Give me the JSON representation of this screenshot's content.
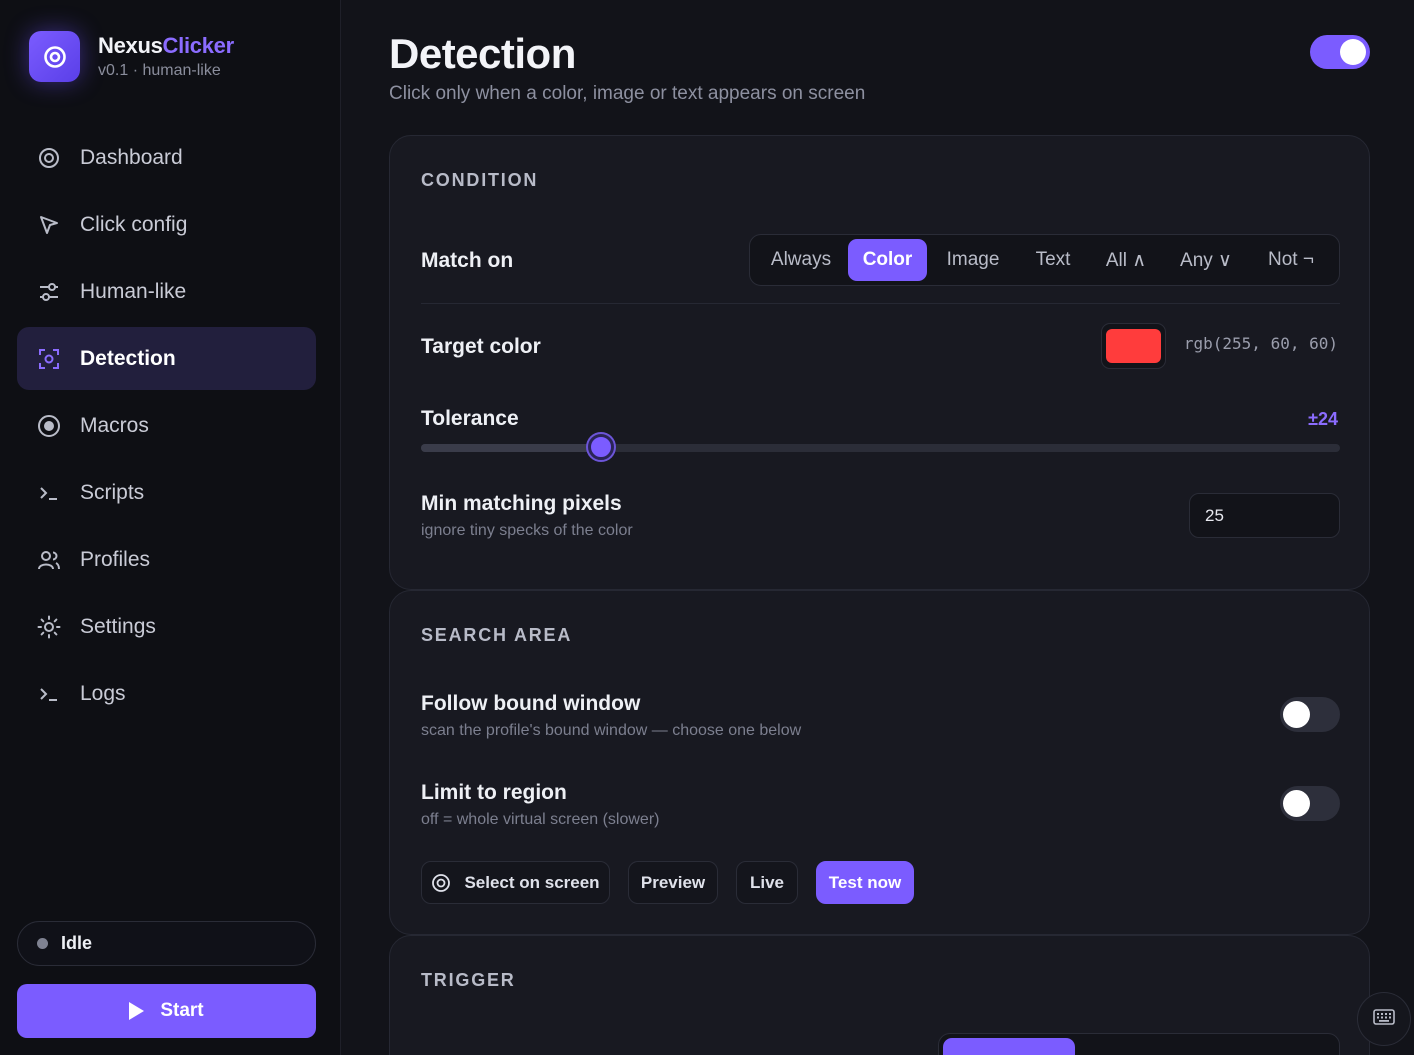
{
  "brand": {
    "name_part1": "Nexus",
    "name_part2": "Clicker",
    "subtitle": "v0.1 · human-like",
    "accent": "#7b5cff"
  },
  "nav": {
    "items": [
      {
        "label": "Dashboard",
        "icon": "target-icon"
      },
      {
        "label": "Click config",
        "icon": "cursor-icon"
      },
      {
        "label": "Human-like",
        "icon": "sliders-icon"
      },
      {
        "label": "Detection",
        "icon": "scan-icon",
        "active": true
      },
      {
        "label": "Macros",
        "icon": "record-icon"
      },
      {
        "label": "Scripts",
        "icon": "terminal-icon"
      },
      {
        "label": "Profiles",
        "icon": "users-icon"
      },
      {
        "label": "Settings",
        "icon": "gear-icon"
      },
      {
        "label": "Logs",
        "icon": "terminal-icon"
      }
    ]
  },
  "status": {
    "label": "Idle"
  },
  "start_button": {
    "label": "Start"
  },
  "page": {
    "title": "Detection",
    "subtitle": "Click only when a color, image or text appears on screen",
    "enabled": true
  },
  "condition": {
    "section_label": "CONDITION",
    "match_on_label": "Match on",
    "match_options": [
      "Always",
      "Color",
      "Image",
      "Text",
      "All ∧",
      "Any ∨",
      "Not ¬"
    ],
    "match_selected": "Color",
    "target_color_label": "Target color",
    "target_color_hex": "#ff3c3c",
    "target_color_text": "rgb(255, 60, 60)",
    "tolerance_label": "Tolerance",
    "tolerance_text": "±24",
    "tolerance_fraction": 0.196,
    "min_pixels_label": "Min matching pixels",
    "min_pixels_hint": "ignore tiny specks of the color",
    "min_pixels_value": "25"
  },
  "search_area": {
    "section_label": "SEARCH AREA",
    "follow_label": "Follow bound window",
    "follow_hint": "scan the profile's bound window — choose one below",
    "follow_on": false,
    "limit_label": "Limit to region",
    "limit_hint": "off = whole virtual screen (slower)",
    "limit_on": false,
    "buttons": {
      "select": "Select on screen",
      "preview": "Preview",
      "live": "Live",
      "test": "Test now"
    }
  },
  "trigger": {
    "section_label": "TRIGGER"
  }
}
